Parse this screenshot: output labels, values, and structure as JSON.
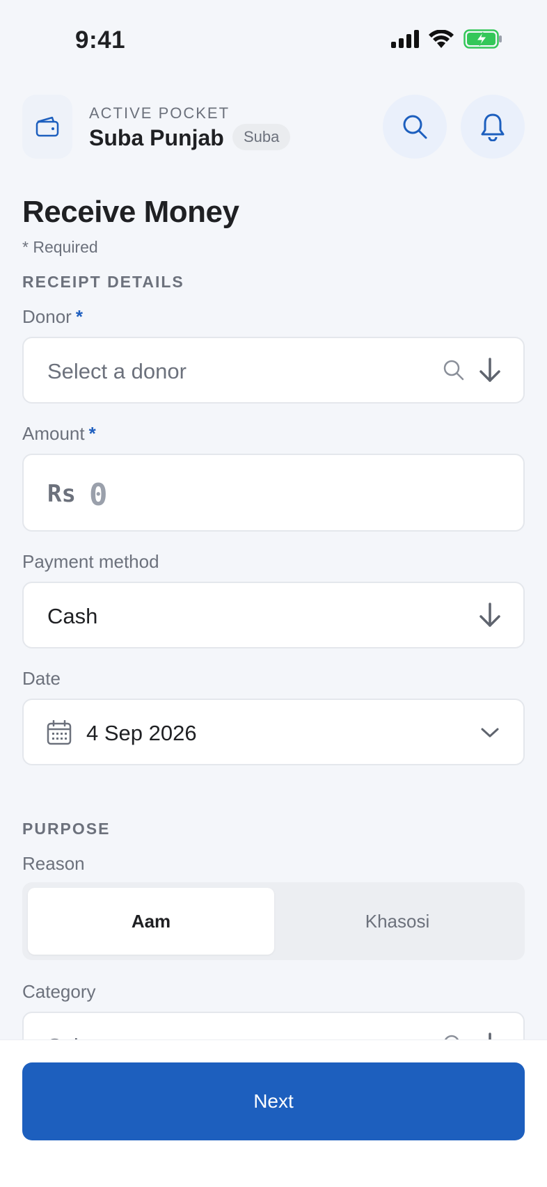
{
  "status_bar": {
    "time": "9:41"
  },
  "header": {
    "eyebrow": "ACTIVE POCKET",
    "pocket_name": "Suba Punjab",
    "pocket_tag": "Suba"
  },
  "page": {
    "title": "Receive Money",
    "required_note": "* Required"
  },
  "receipt_details": {
    "heading": "RECEIPT DETAILS",
    "donor": {
      "label": "Donor",
      "required_mark": "*",
      "placeholder": "Select a donor"
    },
    "amount": {
      "label": "Amount",
      "required_mark": "*",
      "currency": "Rs",
      "value": "0"
    },
    "payment_method": {
      "label": "Payment method",
      "value": "Cash"
    },
    "date": {
      "label": "Date",
      "value": "4 Sep 2026"
    }
  },
  "purpose": {
    "heading": "PURPOSE",
    "reason": {
      "label": "Reason",
      "options": [
        "Aam",
        "Khasosi"
      ],
      "selected": "Aam"
    },
    "category": {
      "label": "Category",
      "placeholder": "Select category"
    }
  },
  "footer": {
    "next_label": "Next"
  },
  "colors": {
    "accent": "#1d5fbe",
    "background": "#f4f6fa",
    "muted": "#6c717c",
    "battery": "#34c759"
  }
}
